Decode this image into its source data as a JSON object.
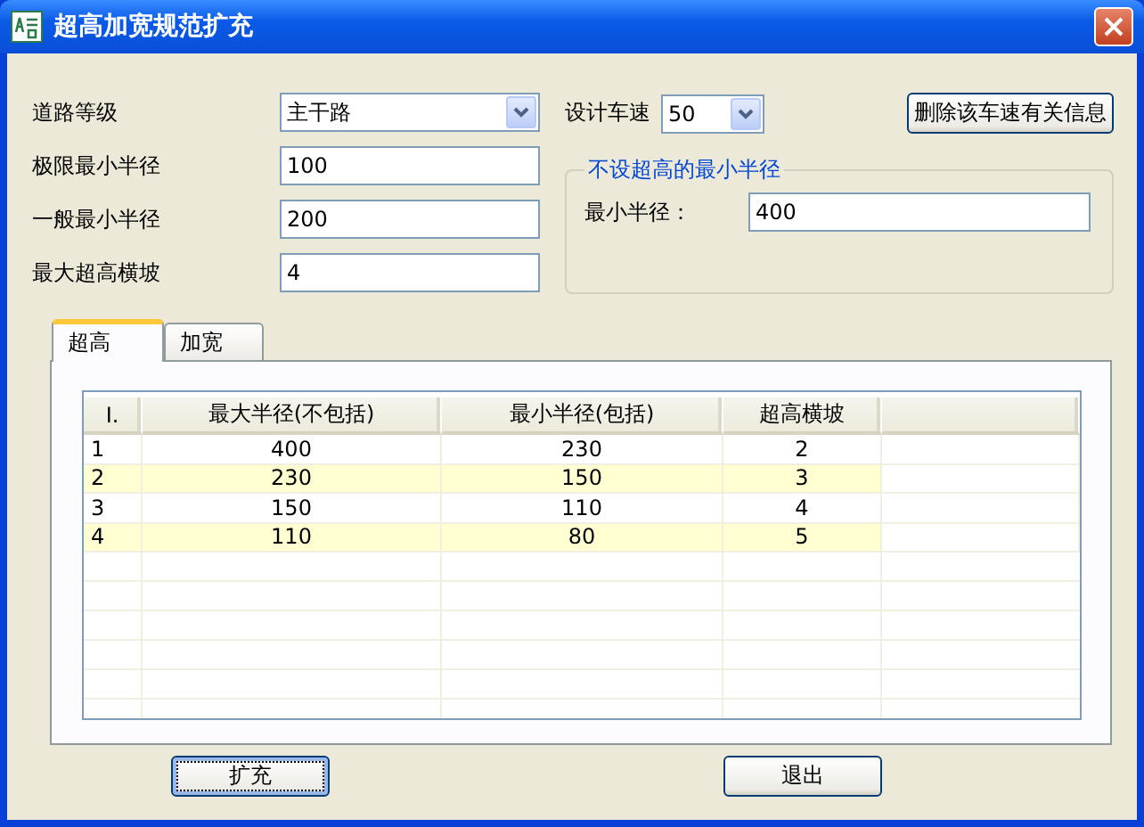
{
  "window": {
    "title": "超高加宽规范扩充"
  },
  "form": {
    "road_grade": {
      "label": "道路等级",
      "value": "主干路"
    },
    "limit_min_radius": {
      "label": "极限最小半径",
      "value": "100"
    },
    "general_min_radius": {
      "label": "一般最小半径",
      "value": "200"
    },
    "max_superelevation": {
      "label": "最大超高横坡",
      "value": "4"
    },
    "design_speed": {
      "label": "设计车速",
      "value": "50"
    },
    "delete_button": "删除该车速有关信息",
    "no_superelevation_group": {
      "title": "不设超高的最小半径",
      "label": "最小半径：",
      "value": "400"
    }
  },
  "tabs": [
    {
      "label": "超高",
      "selected": true
    },
    {
      "label": "加宽",
      "selected": false
    }
  ],
  "table": {
    "columns": [
      "I.",
      "最大半径(不包括)",
      "最小半径(包括)",
      "超高横坡"
    ],
    "rows": [
      [
        "1",
        "400",
        "230",
        "2"
      ],
      [
        "2",
        "230",
        "150",
        "3"
      ],
      [
        "3",
        "150",
        "110",
        "4"
      ],
      [
        "4",
        "110",
        "80",
        "5"
      ]
    ]
  },
  "buttons": [
    {
      "label": "扩充",
      "focused": true
    },
    {
      "label": "退出",
      "focused": false
    }
  ]
}
